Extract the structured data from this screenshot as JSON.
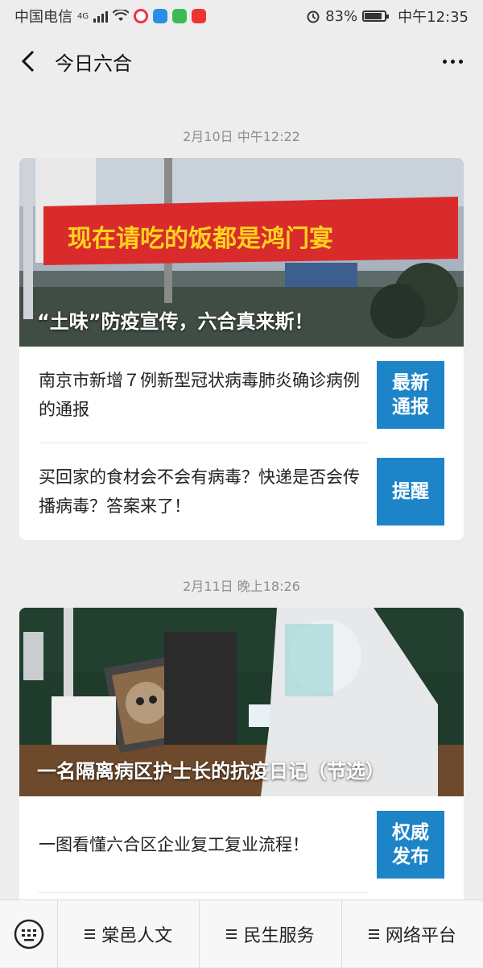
{
  "status_bar": {
    "carrier": "中国电信",
    "network": "4G",
    "battery": "83%",
    "time": "中午12:35"
  },
  "nav": {
    "title": "今日六合",
    "back_icon": "chevron-left-icon",
    "more_icon": "more-dots-icon"
  },
  "messages": [
    {
      "timestamp": "2月10日 中午12:22",
      "cover_title": "“土味”防疫宣传，六合真来斯！",
      "banner_text": "现在请吃的饭都是鸿门宴",
      "items": [
        {
          "text": "南京市新增７例新型冠状病毒肺炎确诊病例的通报",
          "thumb": "最新\n通报"
        },
        {
          "text": "买回家的食材会不会有病毒？快递是否会传播病毒？答案来了！",
          "thumb": "提醒"
        }
      ]
    },
    {
      "timestamp": "2月11日 晚上18:26",
      "cover_title": "一名隔离病区护士长的抗疫日记（节选）",
      "items": [
        {
          "text": "一图看懂六合区企业复工复业流程！",
          "thumb": "权威\n发布"
        }
      ]
    }
  ],
  "bottom_menu": {
    "keyboard_icon": "keyboard-icon",
    "items": [
      "棠邑人文",
      "民生服务",
      "网络平台"
    ]
  },
  "colors": {
    "accent": "#1e84c8",
    "banner": "#d92b2b"
  }
}
